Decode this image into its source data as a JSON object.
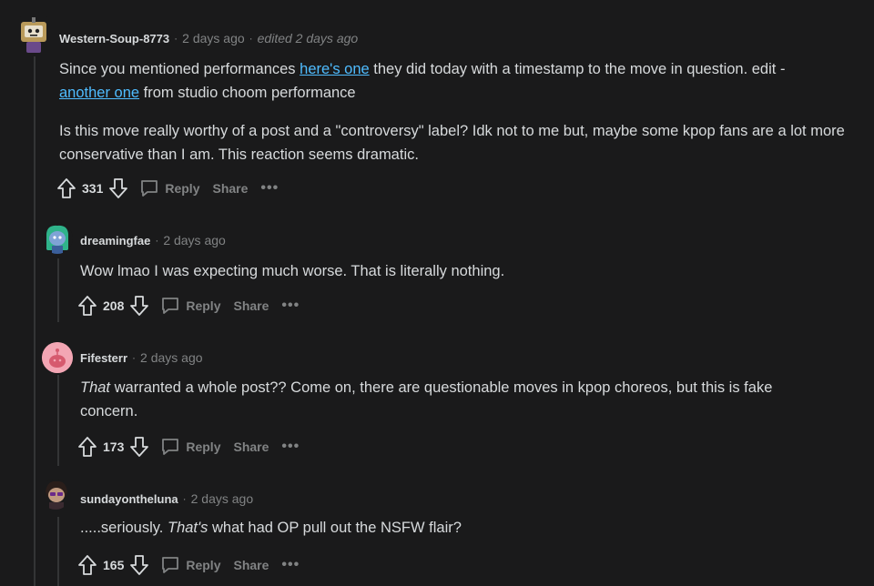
{
  "comments": [
    {
      "username": "Western-Soup-8773",
      "time": "2 days ago",
      "edited": "edited 2 days ago",
      "para1_part1": "Since you mentioned performances ",
      "link1": "here's one",
      "para1_part2": " they did today with a timestamp to the move in question. edit -",
      "link2": "another one",
      "para1_part3": " from studio choom performance",
      "para2": "Is this move really worthy of a post and a \"controversy\" label? Idk not to me but, maybe some kpop fans are a lot more conservative than I am. This reaction seems dramatic.",
      "score": "331",
      "reply_label": "Reply",
      "share_label": "Share",
      "more": "•••"
    },
    {
      "username": "dreamingfae",
      "time": "2 days ago",
      "text": "Wow lmao I was expecting much worse. That is literally nothing.",
      "score": "208",
      "reply_label": "Reply",
      "share_label": "Share",
      "more": "•••"
    },
    {
      "username": "Fifesterr",
      "time": "2 days ago",
      "em": "That",
      "text": " warranted a whole post?? Come on, there are questionable moves in kpop choreos, but this is fake concern.",
      "score": "173",
      "reply_label": "Reply",
      "share_label": "Share",
      "more": "•••"
    },
    {
      "username": "sundayontheluna",
      "time": "2 days ago",
      "pre": ".....seriously. ",
      "em": "That's",
      "post": " what had OP pull out the NSFW flair?",
      "score": "165",
      "reply_label": "Reply",
      "share_label": "Share",
      "more": "•••"
    }
  ],
  "separator": "·",
  "colors": {
    "background": "#1a1a1b",
    "link": "#4fbcff",
    "muted": "#818384",
    "text": "#d7dadc"
  }
}
